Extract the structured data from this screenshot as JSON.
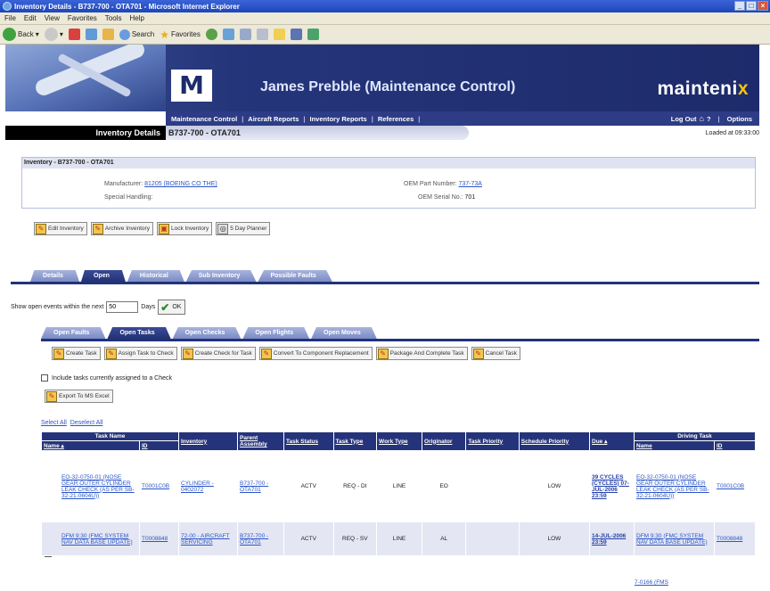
{
  "browser": {
    "title": "Inventory Details - B737-700 - OTA701 - Microsoft Internet Explorer",
    "menu": [
      "File",
      "Edit",
      "View",
      "Favorites",
      "Tools",
      "Help"
    ],
    "toolbar": {
      "back": "Back",
      "search": "Search",
      "favorites": "Favorites"
    }
  },
  "header": {
    "logo": "M",
    "user": "James Prebble (Maintenance Control)",
    "brand": "mainteni",
    "brand_accent": "x",
    "nav": [
      "Maintenance Control",
      "Aircraft Reports",
      "Inventory Reports",
      "References"
    ],
    "logout": "Log Out",
    "home_icon": "home-icon",
    "help": "?",
    "options": "Options"
  },
  "page": {
    "title": "Inventory Details",
    "subtitle": "B737-700 - OTA701",
    "loaded": "Loaded at 09:33:00"
  },
  "details": {
    "header": "Inventory - B737-700 - OTA701",
    "manufacturer_label": "Manufacturer:",
    "manufacturer_value": "81205 (BOEING CO THE)",
    "special_handling_label": "Special Handling:",
    "oem_part_label": "OEM Part Number:",
    "oem_part_value": "737-73A",
    "oem_serial_label": "OEM Serial No.:",
    "oem_serial_value": "701"
  },
  "actions": [
    "Edit Inventory",
    "Archive Inventory",
    "Lock Inventory",
    "5 Day Planner"
  ],
  "main_tabs": [
    "Details",
    "Open",
    "Historical",
    "Sub Inventory",
    "Possible Faults"
  ],
  "main_tab_active": 1,
  "show_events": {
    "label_before": "Show open events within the next",
    "value": "50",
    "label_after": "Days",
    "ok": "OK"
  },
  "sub_tabs": [
    "Open Faults",
    "Open Tasks",
    "Open Checks",
    "Open Flights",
    "Open Moves"
  ],
  "sub_tab_active": 1,
  "task_actions": [
    "Create Task",
    "Assign Task to Check",
    "Create Check for Task",
    "Convert To Component Replacement",
    "Package And Complete Task",
    "Cancel Task"
  ],
  "include_label": "Include tasks currently assigned to a Check",
  "export": "Export To MS Excel",
  "select_all": "Select All",
  "deselect_all": "Deselect All",
  "table": {
    "group_task": "Task Name",
    "group_driving": "Driving Task",
    "columns": [
      "Inventory",
      "Parent Assembly",
      "Task Status",
      "Task Type",
      "Work Type",
      "Originator",
      "Task Priority",
      "Schedule Priority",
      "Due"
    ],
    "sub_name": "Name",
    "sub_id": "ID",
    "rows": [
      {
        "name": "EO-32-0750-01 (NOSE GEAR OUTER CYLINDER LEAK CHECK (AS PER SB-32-21-0604U))",
        "id": "T0001C0B",
        "inventory": "CYLINDER - 0402072",
        "parent": "B737-700 - OTA701",
        "status": "ACTV",
        "type": "REQ - DI",
        "work": "LINE",
        "originator": "EO",
        "task_priority": "",
        "schedule_priority": "LOW",
        "due": "39 CYCLES (CYCLES) 07-JUL-2006 23:59",
        "driving_name": "EO-32-0750-01 (NOSE GEAR OUTER CYLINDER LEAK CHECK (AS PER SB-32-21-0604U))",
        "driving_id": "T0001C0B"
      },
      {
        "name": "DFM 9:30 (FMC SYSTEM NAV DATA BASE UPDATE)",
        "id": "T0008848",
        "inventory": "72-00 - AIRCRAFT SERVICING",
        "parent": "B737-700 - OTA701",
        "status": "ACTV",
        "type": "REQ - SV",
        "work": "LINE",
        "originator": "AL",
        "task_priority": "",
        "schedule_priority": "LOW",
        "due": "14-JUL-2006 23:59",
        "driving_name": "DFM 9:30 (FMC SYSTEM NAV DATA BASE UPDATE)",
        "driving_id": "T0008848"
      }
    ],
    "next_partial": "7-0166 (FMS"
  }
}
